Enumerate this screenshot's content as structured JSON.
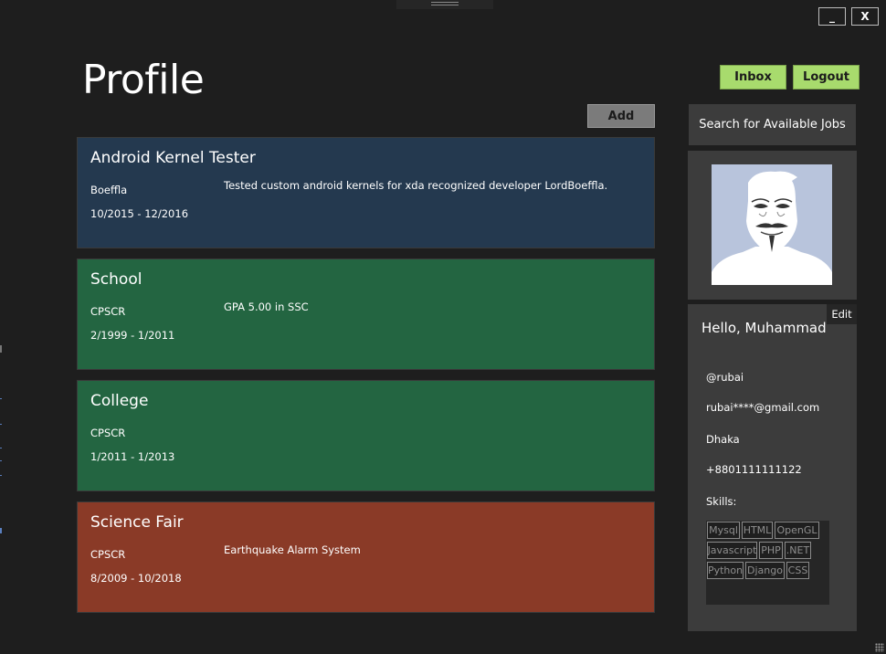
{
  "window": {
    "minimize_label": "_",
    "close_label": "X"
  },
  "header": {
    "title": "Profile",
    "inbox_label": "Inbox",
    "logout_label": "Logout"
  },
  "toolbar": {
    "add_label": "Add"
  },
  "sidebar": {
    "search_jobs_label": "Search for Available Jobs",
    "avatar_icon": "anonymous-mask-avatar"
  },
  "experiences": [
    {
      "title": "Android Kernel Tester",
      "org": "Boeffla",
      "dates": "10/2015 - 12/2016",
      "description": "Tested custom android kernels for xda recognized developer LordBoeffla.",
      "color": "#24394f"
    },
    {
      "title": "School",
      "org": "CPSCR",
      "dates": "2/1999 - 1/2011",
      "description": "GPA 5.00 in SSC",
      "color": "#236541"
    },
    {
      "title": "College",
      "org": "CPSCR",
      "dates": "1/2011 - 1/2013",
      "description": "",
      "color": "#236541"
    },
    {
      "title": "Science Fair",
      "org": "CPSCR",
      "dates": "8/2009 - 10/2018",
      "description": "Earthquake Alarm System",
      "color": "#8a3a27"
    }
  ],
  "user": {
    "edit_label": "Edit",
    "greeting": "Hello, Muhammad",
    "handle": "@rubai",
    "email": "rubai****@gmail.com",
    "city": "Dhaka",
    "phone": "+8801111111122",
    "skills_label": "Skills:",
    "skills": [
      "Mysql",
      "HTML",
      "OpenGL",
      "Javascript",
      "PHP",
      ".NET",
      "Python",
      "Django",
      "CSS"
    ]
  },
  "colors": {
    "background": "#1e1e1e",
    "panel": "#3c3c3c",
    "accent_green": "#a8db6d"
  }
}
